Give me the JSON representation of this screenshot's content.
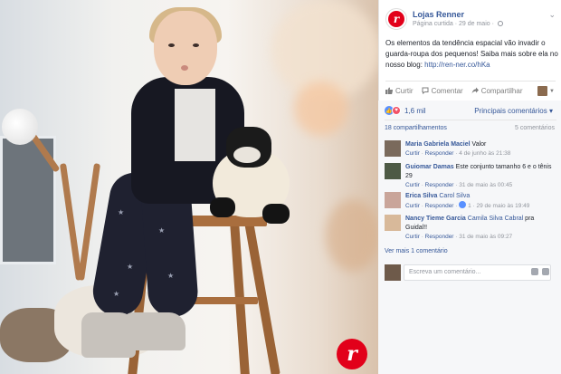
{
  "photo": {
    "alt": "",
    "logo_icon": "lojas-renner-logo-icon",
    "logo_letter": "r"
  },
  "post": {
    "page_name": "Lojas Renner",
    "page_avatar_letter": "r",
    "meta_page": "Página curtida",
    "meta_sep": "·",
    "meta_date": "29 de maio",
    "meta_sep2": "·",
    "text": "Os elementos da tendência espacial vão invadir o guarda-roupa dos pequenos! Saiba mais sobre ela no nosso blog: ",
    "link": "http://ren-ner.co/hKa"
  },
  "actions": {
    "like": "Curtir",
    "comment": "Comentar",
    "share": "Compartilhar"
  },
  "reactions": {
    "count": "1,6 mil",
    "main_comments": "Principais comentários ▾"
  },
  "stats": {
    "shares": "18 compartilhamentos",
    "comments": "5 comentários"
  },
  "comments": [
    {
      "author": "Maria Gabriela Maciel",
      "text": "Valor",
      "mention": "",
      "like": "Curtir",
      "reply": "Responder",
      "likes": "",
      "time": "4 de junho às 21:38"
    },
    {
      "author": "Guiomar Damas",
      "text": "Este conjunto tamanho 6 e o tênis 29",
      "mention": "",
      "like": "Curtir",
      "reply": "Responder",
      "likes": "",
      "time": "31 de maio às 00:45"
    },
    {
      "author": "Erica Silva",
      "text": "",
      "mention": "Carol Silva",
      "like": "Curtir",
      "reply": "Responder",
      "likes": "1",
      "time": "29 de maio às 19:49"
    },
    {
      "author": "Nancy Tieme Garcia",
      "text": " pra Guidal!!",
      "mention": "Camila Silva Cabral",
      "like": "Curtir",
      "reply": "Responder",
      "likes": "",
      "time": "31 de maio às 09:27"
    }
  ],
  "more_comments": "Ver mais 1 comentário",
  "write_comment": {
    "placeholder": "Escreva um comentário..."
  },
  "colors": {
    "link": "#365899",
    "brand_red": "#e2001a",
    "like_blue": "#5890ff",
    "love_red": "#f25268"
  }
}
